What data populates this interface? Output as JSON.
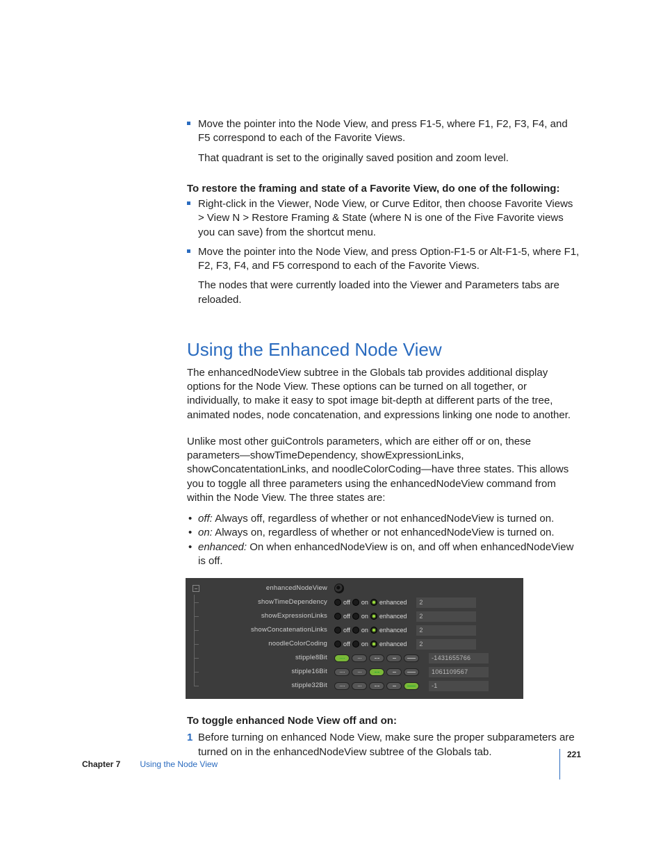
{
  "bullets1": {
    "b1": "Move the pointer into the Node View, and press F1-5, where F1, F2, F3, F4, and F5 correspond to each of the Favorite Views.",
    "p1": "That quadrant is set to the originally saved position and zoom level."
  },
  "restore": {
    "heading": "To restore the framing and state of a Favorite View, do one of the following:",
    "b1": "Right-click in the Viewer, Node View, or Curve Editor, then choose Favorite Views > View N > Restore Framing & State (where N is one of the Five Favorite views you can save) from the shortcut menu.",
    "b2": "Move the pointer into the Node View, and press Option-F1-5 or Alt-F1-5, where F1, F2, F3, F4, and F5 correspond to each of the Favorite Views.",
    "p1": "The nodes that were currently loaded into the Viewer and Parameters tabs are reloaded."
  },
  "section": {
    "title": "Using the Enhanced Node View",
    "p1": "The enhancedNodeView subtree in the Globals tab provides additional display options for the Node View. These options can be turned on all together, or individually, to make it easy to spot image bit-depth at different parts of the tree, animated nodes, node concatenation, and expressions linking one node to another.",
    "p2": "Unlike most other guiControls parameters, which are either off or on, these parameters—showTimeDependency, showExpressionLinks, showConcatentationLinks, and noodleColorCoding—have three states. This allows you to toggle all three parameters using the enhancedNodeView command from within the Node View. The three states are:",
    "states": {
      "off_label": "off:",
      "off_text": "  Always off, regardless of whether or not enhancedNodeView is turned on.",
      "on_label": "on:",
      "on_text": "  Always on, regardless of whether or not enhancedNodeView is turned on.",
      "enh_label": "enhanced:",
      "enh_text": "  On when enhancedNodeView is on, and off when enhancedNodeView is off."
    }
  },
  "panel": {
    "group": "enhancedNodeView",
    "rows": {
      "r1": {
        "label": "showTimeDependency",
        "opt_off": "off",
        "opt_on": "on",
        "opt_enh": "enhanced",
        "value": "2"
      },
      "r2": {
        "label": "showExpressionLinks",
        "opt_off": "off",
        "opt_on": "on",
        "opt_enh": "enhanced",
        "value": "2"
      },
      "r3": {
        "label": "showConcatenationLinks",
        "opt_off": "off",
        "opt_on": "on",
        "opt_enh": "enhanced",
        "value": "2"
      },
      "r4": {
        "label": "noodleColorCoding",
        "opt_off": "off",
        "opt_on": "on",
        "opt_enh": "enhanced",
        "value": "2"
      },
      "r5": {
        "label": "stipple8Bit",
        "value": "-1431655766"
      },
      "r6": {
        "label": "stipple16Bit",
        "value": "1061109567"
      },
      "r7": {
        "label": "stipple32Bit",
        "value": "-1"
      }
    }
  },
  "toggle": {
    "heading": "To toggle enhanced Node View off and on:",
    "step1_num": "1",
    "step1": "Before turning on enhanced Node View, make sure the proper subparameters are turned on in the enhancedNodeView subtree of the Globals tab."
  },
  "footer": {
    "chapter": "Chapter 7",
    "name": "Using the Node View",
    "page": "221"
  }
}
